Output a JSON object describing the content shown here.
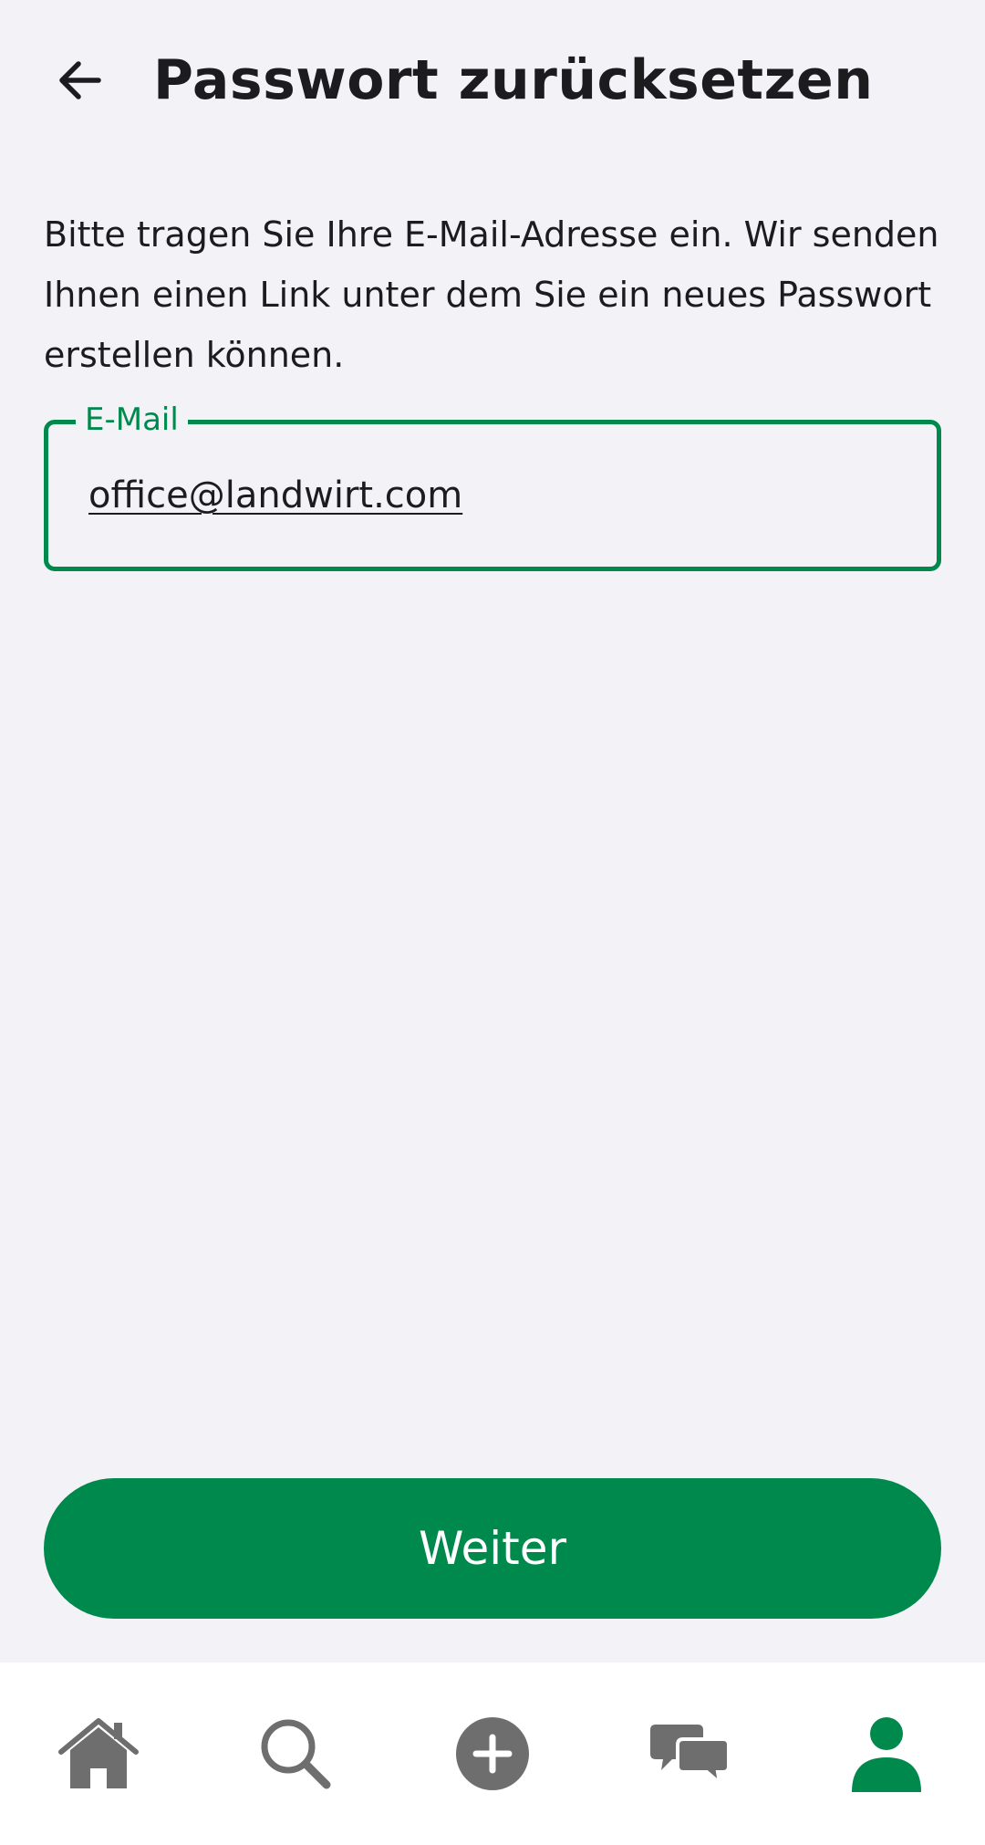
{
  "header": {
    "back_icon": "arrow-left-icon",
    "title": "Passwort zurücksetzen"
  },
  "description": "Bitte tragen Sie Ihre E-Mail-Adresse ein. Wir senden Ihnen einen Link unter dem Sie ein neues Passwort erstellen können.",
  "email_field": {
    "label": "E-Mail",
    "value": "office@landwirt.com"
  },
  "continue_button": {
    "label": "Weiter"
  },
  "bottom_nav": {
    "items": [
      {
        "icon": "home-icon",
        "active": false
      },
      {
        "icon": "search-icon",
        "active": false
      },
      {
        "icon": "add-circle-icon",
        "active": false
      },
      {
        "icon": "chat-icon",
        "active": false
      },
      {
        "icon": "profile-icon",
        "active": true
      }
    ]
  },
  "colors": {
    "accent": "#00894c",
    "background": "#f2f2f7",
    "nav_background": "#ffffff",
    "icon_inactive": "#6e6e6e",
    "text": "#1c1c1e"
  }
}
